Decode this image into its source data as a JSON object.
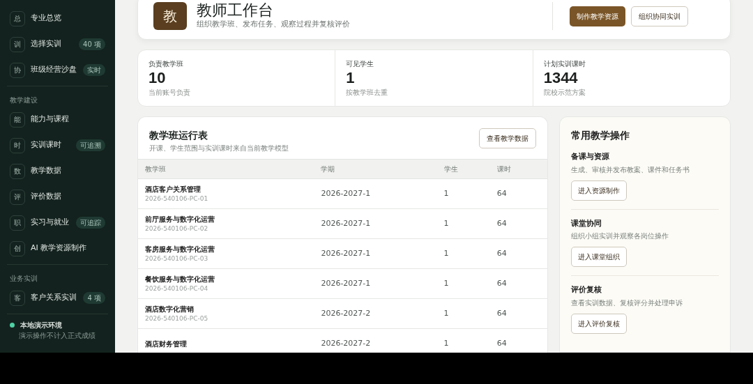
{
  "sidebar": {
    "groups": [
      {
        "items": [
          {
            "icon": "总",
            "label": "专业总览"
          },
          {
            "icon": "训",
            "label": "选择实训",
            "badge": "40 项"
          },
          {
            "icon": "协",
            "label": "班级经营沙盘",
            "badge": "实时"
          }
        ]
      },
      {
        "title": "教学建设",
        "items": [
          {
            "icon": "能",
            "label": "能力与课程"
          },
          {
            "icon": "时",
            "label": "实训课时",
            "badge": "可追溯"
          },
          {
            "icon": "数",
            "label": "教学数据"
          },
          {
            "icon": "评",
            "label": "评价数据"
          },
          {
            "icon": "职",
            "label": "实习与就业",
            "badge": "可追踪"
          },
          {
            "icon": "创",
            "label": "AI 教学资源制作"
          }
        ]
      },
      {
        "title": "业务实训",
        "items": [
          {
            "icon": "客",
            "label": "客户关系实训",
            "badge": "4 项"
          }
        ]
      }
    ],
    "environment": {
      "color": "#4fd1a5",
      "title": "本地演示环境",
      "note": "演示操作不计入正式成绩"
    }
  },
  "header": {
    "logo": "教",
    "title": "教师工作台",
    "subtitle": "组织教学班、发布任务、观察过程并复核评价",
    "buttons": [
      {
        "label": "制作教学资源",
        "kind": "primary"
      },
      {
        "label": "组织协同实训",
        "kind": "outline"
      }
    ]
  },
  "stats": [
    {
      "label": "负责教学班",
      "value": "10",
      "note": "当前账号负责"
    },
    {
      "label": "可见学生",
      "value": "1",
      "note": "按教学班去重"
    },
    {
      "label": "计划实训课时",
      "value": "1344",
      "note": "院校示范方案"
    }
  ],
  "class_table": {
    "title": "教学班运行表",
    "subtitle": "开课、学生范围与实训课时来自当前教学模型",
    "button": "查看教学数据",
    "columns": [
      "教学班",
      "学期",
      "学生",
      "课时"
    ],
    "rows": [
      {
        "name": "酒店客户关系管理",
        "code": "2026-540106-PC-01",
        "term": "2026-2027-1",
        "students": "1",
        "hours": "64"
      },
      {
        "name": "前厅服务与数字化运营",
        "code": "2026-540106-PC-02",
        "term": "2026-2027-1",
        "students": "1",
        "hours": "64"
      },
      {
        "name": "客房服务与数字化运营",
        "code": "2026-540106-PC-03",
        "term": "2026-2027-1",
        "students": "1",
        "hours": "64"
      },
      {
        "name": "餐饮服务与数字化运营",
        "code": "2026-540106-PC-04",
        "term": "2026-2027-1",
        "students": "1",
        "hours": "64"
      },
      {
        "name": "酒店数字化营销",
        "code": "2026-540106-PC-05",
        "term": "2026-2027-2",
        "students": "1",
        "hours": "64"
      },
      {
        "name": "酒店财务管理",
        "term": "2026-2027-2",
        "students": "1",
        "hours": "64"
      }
    ]
  },
  "actions": {
    "title": "常用教学操作",
    "items": [
      {
        "title": "备课与资源",
        "text": "生成、审核并发布教案、课件和任务书",
        "button": "进入资源制作"
      },
      {
        "title": "课堂协同",
        "text": "组织小组实训并观察各岗位操作",
        "button": "进入课堂组织"
      },
      {
        "title": "评价复核",
        "text": "查看实训数据、复核评分并处理申诉",
        "button": "进入评价复核"
      }
    ]
  }
}
